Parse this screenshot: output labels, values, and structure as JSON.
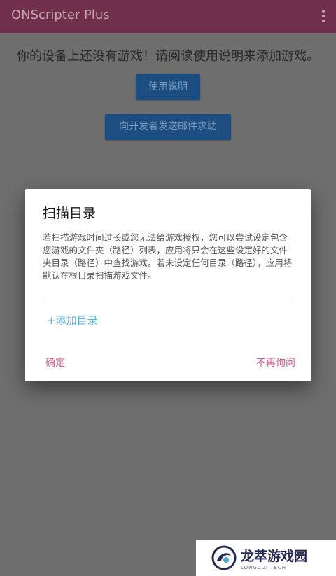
{
  "app_bar": {
    "title": "ONScripter Plus",
    "overflow_icon": "more-vert-icon"
  },
  "main": {
    "empty_message": "你的设备上还没有游戏！请阅读使用说明来添加游戏。",
    "help_button": "使用说明",
    "email_button": "向开发者发送邮件求助"
  },
  "dialog": {
    "title": "扫描目录",
    "body": "若扫描游戏时间过长或您无法给游戏授权，您可以尝试设定包含您游戏的文件夹（路径）列表，应用将只会在这些设定好的文件夹目录（路径）中查找游戏。若未设定任何目录（路径），应用将默认在根目录扫描游戏文件。",
    "add_directory": "+添加目录",
    "confirm": "确定",
    "never_ask": "不再询问"
  },
  "watermark": {
    "name": "龙萃游戏园",
    "sub": "LONGCUI TECH"
  },
  "colors": {
    "app_bar": "#702f4b",
    "scrim_bg": "#6e6e6e",
    "dim_button": "#1d4e82",
    "link_blue": "#5aaee9",
    "accent_pink": "#e05a8a"
  }
}
